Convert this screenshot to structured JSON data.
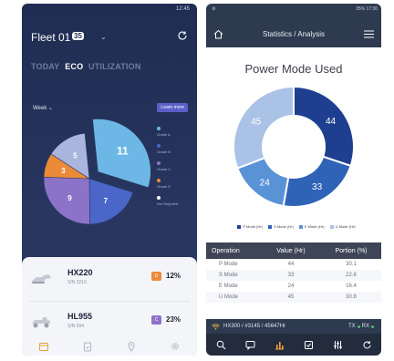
{
  "left_app": {
    "status_time": "12:45",
    "fleet_title": "Fleet 01",
    "fleet_count": "35",
    "tabs": [
      {
        "label": "TODAY",
        "active": false
      },
      {
        "label": "ECO",
        "active": true
      },
      {
        "label": "UTILIZATION",
        "active": false
      }
    ],
    "period_selector": "Week",
    "learn_more_label": "Learn more",
    "pie": {
      "slices": [
        {
          "value": 11,
          "label": "11",
          "color": "#6cb7e5"
        },
        {
          "value": 7,
          "label": "7",
          "color": "#4a66c9"
        },
        {
          "value": 9,
          "label": "9",
          "color": "#8c73c8"
        },
        {
          "value": 3,
          "label": "3",
          "color": "#ec8a3a"
        },
        {
          "value": 5,
          "label": "5",
          "color": "#aab5dd"
        }
      ]
    },
    "legend": [
      {
        "label": "Grade A",
        "color": "#6cb7e5"
      },
      {
        "label": "Grade B",
        "color": "#4a66c9"
      },
      {
        "label": "Grade C",
        "color": "#8c73c8"
      },
      {
        "label": "Grade D",
        "color": "#ec8a3a"
      },
      {
        "label": "Not Rejected",
        "color": "#ffffff"
      }
    ],
    "machines": [
      {
        "name": "HX220",
        "sn": "S/N 3210",
        "grade": "D",
        "grade_color": "#ec8a3a",
        "percent": "12%"
      },
      {
        "name": "HL955",
        "sn": "S/N 934",
        "grade": "C",
        "grade_color": "#8c73c8",
        "percent": "23%"
      }
    ],
    "nav_icons": [
      "calendar-icon",
      "clipboard-icon",
      "location-icon",
      "settings-icon"
    ]
  },
  "right_app": {
    "status_right": "35% 17:30",
    "title": "Statistics / Analysis",
    "chart_title": "Power Mode Used",
    "chart_data": {
      "type": "pie",
      "categories": [
        "P Mode",
        "S Mode",
        "E Mode",
        "U Mode"
      ],
      "values": [
        44,
        33,
        24,
        45
      ],
      "colors": [
        "#1e3f8f",
        "#2e63b8",
        "#5a92d6",
        "#a9c2e6"
      ],
      "labels": [
        "44",
        "33",
        "24",
        "45"
      ]
    },
    "legend": [
      {
        "label": "P Mode (Hr)",
        "color": "#1e3f8f"
      },
      {
        "label": "S Mode (Hr)",
        "color": "#2e63b8"
      },
      {
        "label": "E Mode (Hr)",
        "color": "#5a92d6"
      },
      {
        "label": "U Mode (Hr)",
        "color": "#a9c2e6"
      }
    ],
    "table": {
      "headers": [
        "Operation",
        "Value (Hr)",
        "Portion (%)"
      ],
      "rows": [
        [
          "P Mode",
          "44",
          "30.1"
        ],
        [
          "S Mode",
          "33",
          "22.6"
        ],
        [
          "E Mode",
          "24",
          "16.4"
        ],
        [
          "U Mode",
          "45",
          "30.8"
        ]
      ]
    },
    "device_info": "HX300 / #3145 / 45647Hr",
    "tx_label": "TX",
    "rx_label": "RX",
    "tx_color": "#3ec46d",
    "rx_color": "#3ec46d"
  }
}
